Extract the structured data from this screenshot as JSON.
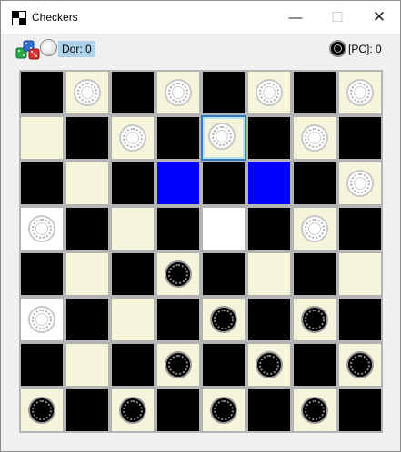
{
  "window": {
    "title": "Checkers",
    "controls": [
      "minimize-icon",
      "maximize-icon",
      "close-icon"
    ]
  },
  "scoreboard": {
    "player_label": "Dor: 0",
    "pc_label": "[PC]: 0",
    "dice_icon": "dice-icon"
  },
  "colors": {
    "dark_square": "#000000",
    "light_square": "#f5f5dc",
    "move_hint": "#0000ff",
    "selected_border": "#2f7cc9",
    "player_score_bg": "#aed2ea"
  },
  "board": [
    [
      "D",
      "LW",
      "D",
      "LW",
      "D",
      "LW",
      "D",
      "LW"
    ],
    [
      "L",
      "D",
      "LW",
      "D",
      "SW",
      "D",
      "LW",
      "D"
    ],
    [
      "D",
      "L",
      "D",
      "M",
      "D",
      "M",
      "D",
      "LW"
    ],
    [
      "BW",
      "D",
      "L",
      "D",
      "B",
      "D",
      "LW",
      "D"
    ],
    [
      "D",
      "L",
      "D",
      "LB",
      "D",
      "L",
      "D",
      "L"
    ],
    [
      "BW",
      "D",
      "L",
      "D",
      "LB",
      "D",
      "LB",
      "D"
    ],
    [
      "D",
      "L",
      "D",
      "LB",
      "D",
      "LB",
      "D",
      "LB"
    ],
    [
      "LB",
      "D",
      "LB",
      "D",
      "LB",
      "D",
      "LB",
      "D"
    ]
  ]
}
